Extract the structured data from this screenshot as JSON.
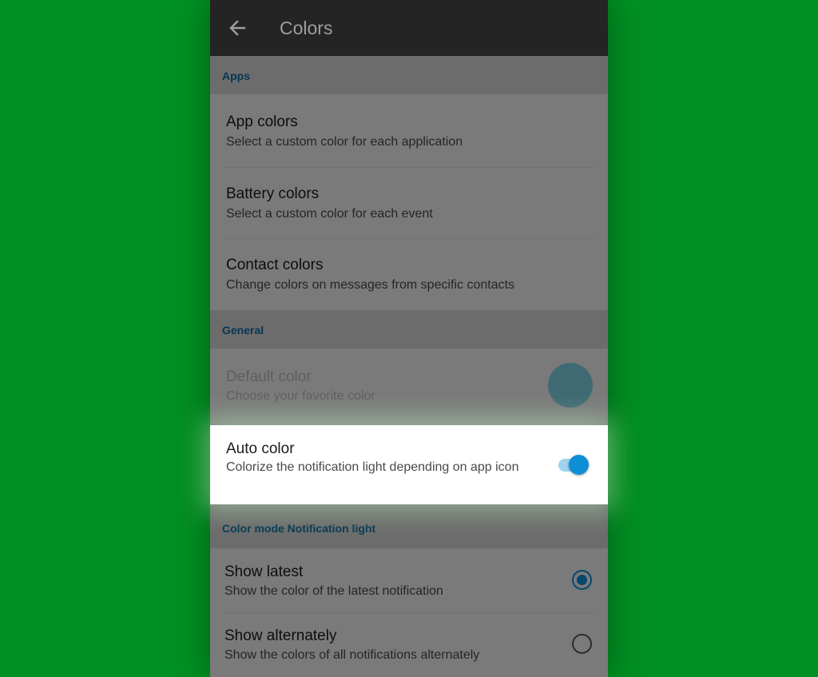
{
  "appbar": {
    "title": "Colors",
    "back_icon": "arrow-left-icon"
  },
  "sections": {
    "apps": "Apps",
    "general": "General",
    "color_mode": "Color mode Notification light"
  },
  "apps_items": [
    {
      "title": "App colors",
      "summary": "Select a custom color for each application"
    },
    {
      "title": "Battery colors",
      "summary": "Select a custom color for each event"
    },
    {
      "title": "Contact colors",
      "summary": "Change colors on messages from specific contacts"
    }
  ],
  "general_items": {
    "default_color": {
      "title": "Default color",
      "summary": "Choose your favorite color",
      "swatch": "#7fd4e6"
    },
    "auto_color": {
      "title": "Auto color",
      "summary": "Colorize the notification light depending on app icon",
      "enabled": true
    }
  },
  "color_mode_items": [
    {
      "title": "Show latest",
      "summary": "Show the color of the latest notification",
      "selected": true
    },
    {
      "title": "Show alternately",
      "summary": "Show the colors of all notifications alternately",
      "selected": false
    }
  ],
  "colors": {
    "accent": "#0f8fd6",
    "header_text": "#0f6fa5",
    "background": "#008f22",
    "appbar": "#242424"
  }
}
